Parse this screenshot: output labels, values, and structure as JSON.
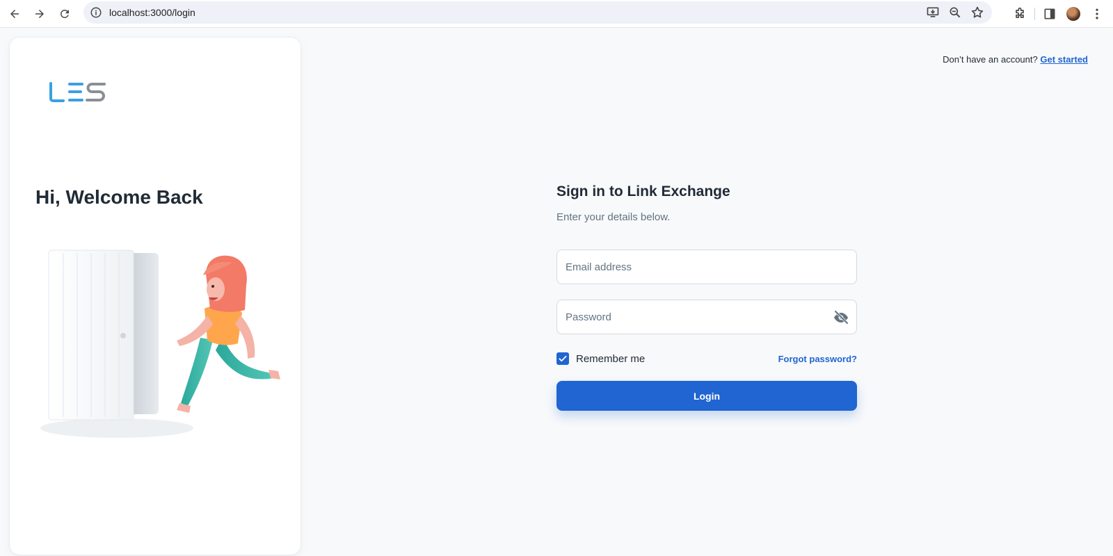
{
  "browser": {
    "url": "localhost:3000/login"
  },
  "brand": {
    "logo_text": "LES",
    "primary_color": "#2065d1",
    "logo_blue": "#3aa0e3",
    "logo_gray": "#8a8f96"
  },
  "left_panel": {
    "welcome": "Hi, Welcome Back"
  },
  "header": {
    "signup_prompt": "Don’t have an account?",
    "signup_link": "Get started"
  },
  "form": {
    "title": "Sign in to Link Exchange",
    "subtitle": "Enter your details below.",
    "email_placeholder": "Email address",
    "password_placeholder": "Password",
    "remember_label": "Remember me",
    "remember_checked": true,
    "forgot_label": "Forgot password?",
    "submit_label": "Login"
  }
}
